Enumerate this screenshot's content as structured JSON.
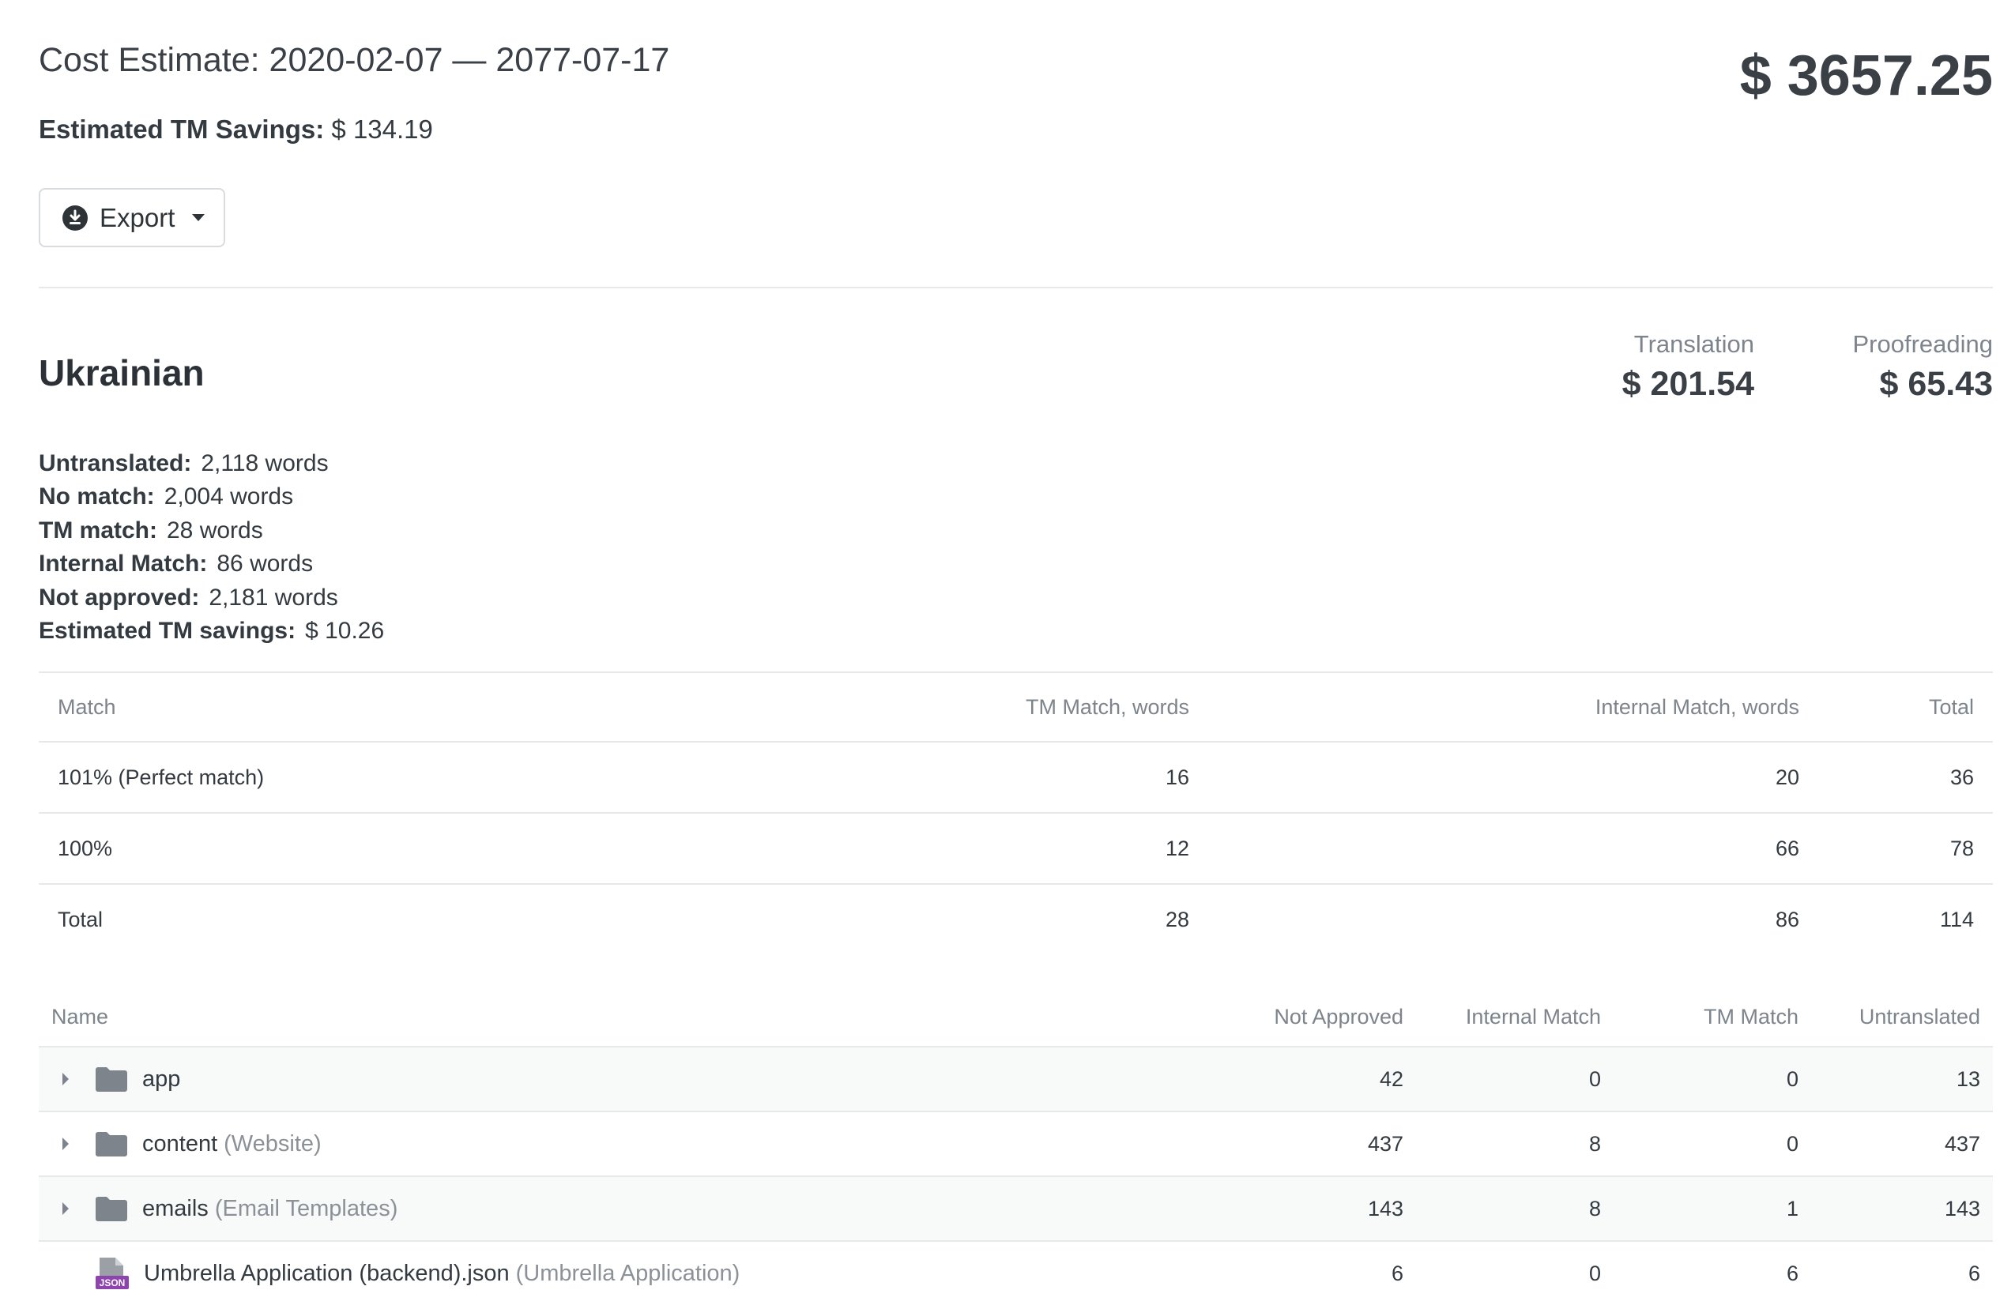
{
  "header": {
    "title": "Cost Estimate: 2020-02-07 — 2077-07-17",
    "grand_total": "$ 3657.25",
    "savings_label": "Estimated TM Savings:",
    "savings_value": "$ 134.19"
  },
  "toolbar": {
    "export_label": "Export"
  },
  "language": {
    "name": "Ukrainian",
    "translation_label": "Translation",
    "translation_value": "$ 201.54",
    "proofreading_label": "Proofreading",
    "proofreading_value": "$ 65.43",
    "stats": [
      {
        "label": "Untranslated:",
        "value": "2,118 words"
      },
      {
        "label": "No match:",
        "value": "2,004 words"
      },
      {
        "label": "TM match:",
        "value": "28 words"
      },
      {
        "label": "Internal Match:",
        "value": "86 words"
      },
      {
        "label": "Not approved:",
        "value": "2,181 words"
      },
      {
        "label": "Estimated TM savings:",
        "value": "$ 10.26"
      }
    ]
  },
  "match_table": {
    "headers": [
      "Match",
      "TM Match, words",
      "Internal Match, words",
      "Total"
    ],
    "rows": [
      [
        "101% (Perfect match)",
        "16",
        "20",
        "36"
      ],
      [
        "100%",
        "12",
        "66",
        "78"
      ],
      [
        "Total",
        "28",
        "86",
        "114"
      ]
    ]
  },
  "files_table": {
    "headers": [
      "Name",
      "Not Approved",
      "Internal Match",
      "TM Match",
      "Untranslated"
    ],
    "rows": [
      {
        "name": "app",
        "sub": "",
        "values": [
          "42",
          "0",
          "0",
          "13"
        ]
      },
      {
        "name": "content",
        "sub": "(Website)",
        "values": [
          "437",
          "8",
          "0",
          "437"
        ]
      },
      {
        "name": "emails",
        "sub": "(Email Templates)",
        "values": [
          "143",
          "8",
          "1",
          "143"
        ]
      },
      {
        "name": "Umbrella Application (backend).json",
        "sub": "(Umbrella Application)",
        "values": [
          "6",
          "0",
          "6",
          "6"
        ]
      }
    ]
  },
  "icons": {
    "export": "download-circle-icon",
    "folder": "folder-icon",
    "json_file": "json-file-icon",
    "json_badge": "JSON"
  },
  "colors": {
    "text": "#333a40",
    "muted": "#7d848b",
    "border": "#e6e8ea",
    "folder": "#7d848b",
    "json_badge": "#8e44ad"
  }
}
